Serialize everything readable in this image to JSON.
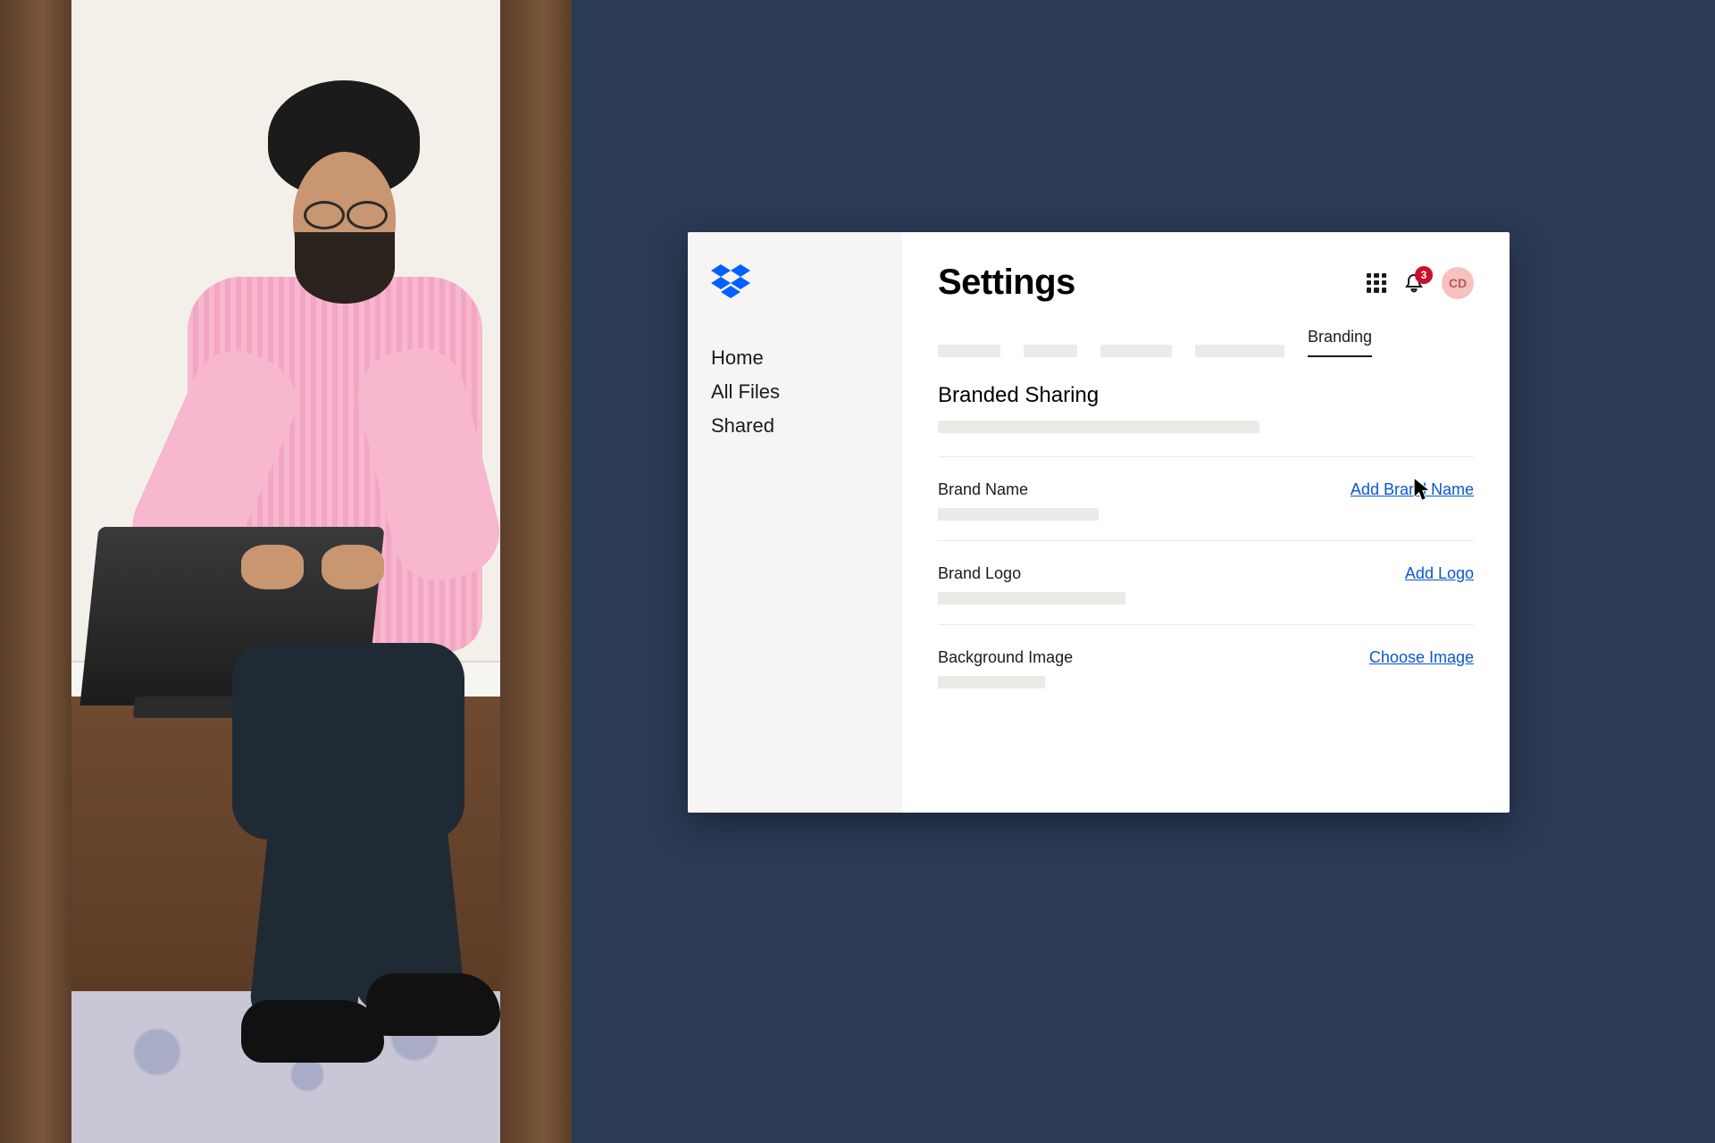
{
  "sidebar": {
    "items": [
      {
        "label": "Home"
      },
      {
        "label": "All Files"
      },
      {
        "label": "Shared"
      }
    ]
  },
  "header": {
    "title": "Settings",
    "notification_count": "3",
    "avatar_initials": "CD"
  },
  "tabs": {
    "active_label": "Branding"
  },
  "branding": {
    "section_title": "Branded Sharing",
    "rows": [
      {
        "label": "Brand Name",
        "action": "Add Brand Name"
      },
      {
        "label": "Brand Logo",
        "action": "Add Logo"
      },
      {
        "label": "Background Image",
        "action": "Choose Image"
      }
    ]
  },
  "colors": {
    "background_navy": "#2b3a55",
    "link_blue": "#0a57d0",
    "badge_red": "#c8102e",
    "avatar_bg": "#f6c1bf"
  }
}
